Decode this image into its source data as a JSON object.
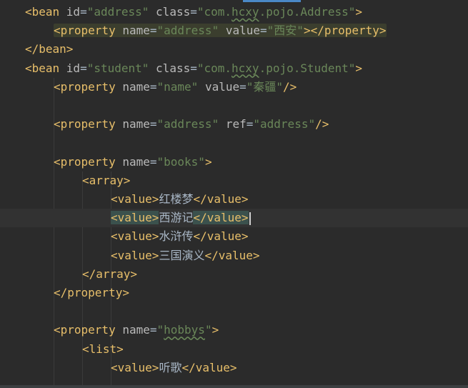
{
  "editor": {
    "lines": [
      {
        "indent": 0,
        "tokens": [
          [
            "b",
            "<bean "
          ],
          [
            "a",
            "id"
          ],
          [
            "t",
            "="
          ],
          [
            "v",
            "\"address\""
          ],
          [
            "t",
            " "
          ],
          [
            "a",
            "class"
          ],
          [
            "t",
            "="
          ],
          [
            "v",
            "\"com."
          ],
          [
            "vw",
            "hcxy"
          ],
          [
            "v",
            ".pojo.Address\""
          ],
          [
            "b",
            ">"
          ]
        ]
      },
      {
        "indent": 1,
        "highlight": true,
        "tokens": [
          [
            "b",
            "<property "
          ],
          [
            "a",
            "name"
          ],
          [
            "t",
            "="
          ],
          [
            "v",
            "\"address\""
          ],
          [
            "t",
            " "
          ],
          [
            "a",
            "value"
          ],
          [
            "t",
            "="
          ],
          [
            "v",
            "\"西安\""
          ],
          [
            "b",
            "></property>"
          ]
        ]
      },
      {
        "indent": 0,
        "tokens": [
          [
            "b",
            "</bean>"
          ]
        ]
      },
      {
        "indent": 0,
        "tokens": [
          [
            "b",
            "<bean "
          ],
          [
            "a",
            "id"
          ],
          [
            "t",
            "="
          ],
          [
            "v",
            "\"student\""
          ],
          [
            "t",
            " "
          ],
          [
            "a",
            "class"
          ],
          [
            "t",
            "="
          ],
          [
            "v",
            "\"com."
          ],
          [
            "vw",
            "hcxy"
          ],
          [
            "v",
            ".pojo.Student\""
          ],
          [
            "b",
            ">"
          ]
        ]
      },
      {
        "indent": 1,
        "tokens": [
          [
            "b",
            "<property "
          ],
          [
            "a",
            "name"
          ],
          [
            "t",
            "="
          ],
          [
            "v",
            "\"name\""
          ],
          [
            "t",
            " "
          ],
          [
            "a",
            "value"
          ],
          [
            "t",
            "="
          ],
          [
            "v",
            "\"秦疆\""
          ],
          [
            "b",
            "/>"
          ]
        ]
      },
      {
        "indent": 0,
        "tokens": []
      },
      {
        "indent": 1,
        "tokens": [
          [
            "b",
            "<property "
          ],
          [
            "a",
            "name"
          ],
          [
            "t",
            "="
          ],
          [
            "v",
            "\"address\""
          ],
          [
            "t",
            " "
          ],
          [
            "a",
            "ref"
          ],
          [
            "t",
            "="
          ],
          [
            "v",
            "\"address\""
          ],
          [
            "b",
            "/>"
          ]
        ]
      },
      {
        "indent": 0,
        "tokens": []
      },
      {
        "indent": 1,
        "tokens": [
          [
            "b",
            "<property "
          ],
          [
            "a",
            "name"
          ],
          [
            "t",
            "="
          ],
          [
            "v",
            "\"books\""
          ],
          [
            "b",
            ">"
          ]
        ]
      },
      {
        "indent": 2,
        "tokens": [
          [
            "b",
            "<array>"
          ]
        ]
      },
      {
        "indent": 3,
        "tokens": [
          [
            "b",
            "<value>"
          ],
          [
            "t",
            "红楼梦"
          ],
          [
            "b",
            "</value>"
          ]
        ]
      },
      {
        "indent": 3,
        "caret": true,
        "tokens": [
          [
            "bh",
            "<value>"
          ],
          [
            "t",
            "西游记"
          ],
          [
            "bh",
            "</value>"
          ]
        ]
      },
      {
        "indent": 3,
        "tokens": [
          [
            "b",
            "<value>"
          ],
          [
            "t",
            "水浒传"
          ],
          [
            "b",
            "</value>"
          ]
        ]
      },
      {
        "indent": 3,
        "tokens": [
          [
            "b",
            "<value>"
          ],
          [
            "t",
            "三国演义"
          ],
          [
            "b",
            "</value>"
          ]
        ]
      },
      {
        "indent": 2,
        "tokens": [
          [
            "b",
            "</array>"
          ]
        ]
      },
      {
        "indent": 1,
        "tokens": [
          [
            "b",
            "</property>"
          ]
        ]
      },
      {
        "indent": 0,
        "tokens": []
      },
      {
        "indent": 1,
        "tokens": [
          [
            "b",
            "<property "
          ],
          [
            "a",
            "name"
          ],
          [
            "t",
            "="
          ],
          [
            "v",
            "\""
          ],
          [
            "vw",
            "hobbys"
          ],
          [
            "v",
            "\""
          ],
          [
            "b",
            ">"
          ]
        ]
      },
      {
        "indent": 2,
        "tokens": [
          [
            "b",
            "<list>"
          ]
        ]
      },
      {
        "indent": 3,
        "tokens": [
          [
            "b",
            "<value>"
          ],
          [
            "t",
            "听歌"
          ],
          [
            "b",
            "</value>"
          ]
        ]
      }
    ]
  },
  "gutter": {
    "icon": "lightbulb-icon"
  },
  "colors": {
    "background": "#2b2b2b",
    "tag": "#e8bf6a",
    "attr": "#bababa",
    "string": "#6a8759",
    "text": "#a9b7c6"
  }
}
